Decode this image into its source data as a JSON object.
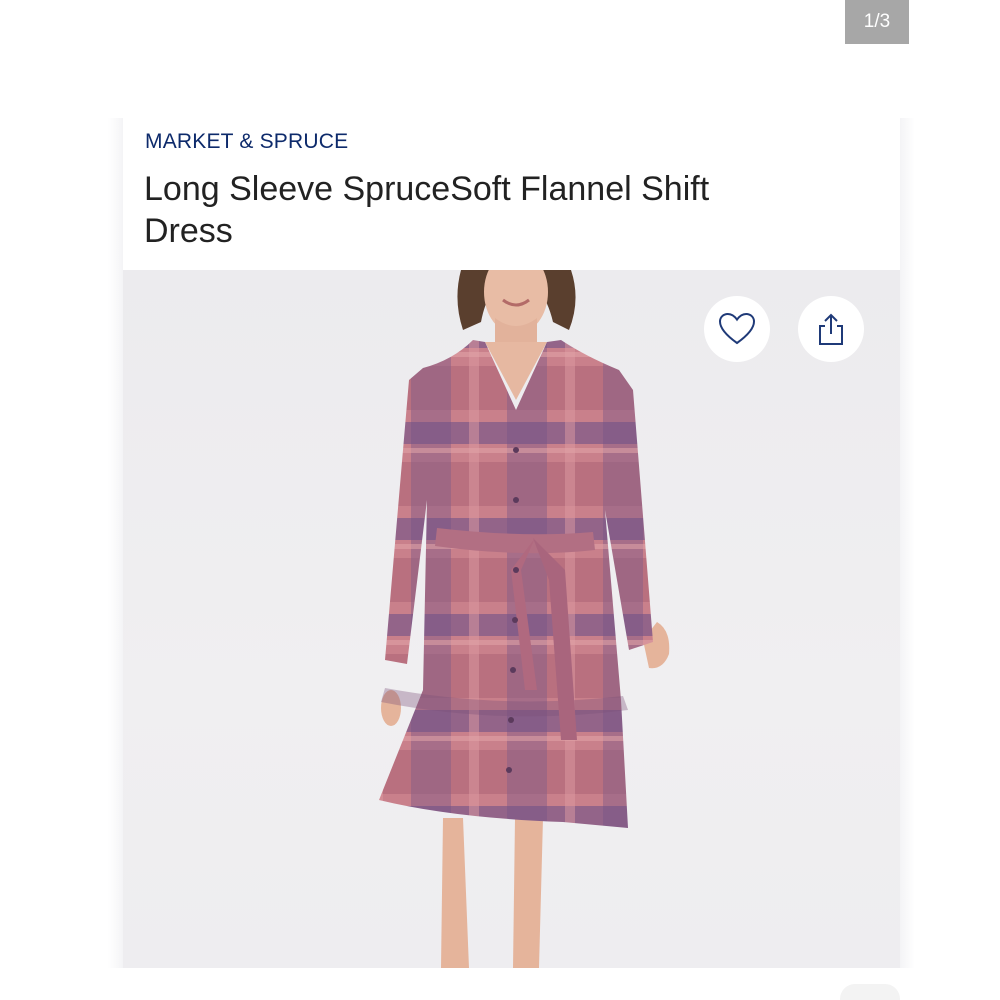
{
  "gallery": {
    "counter": "1/3"
  },
  "product": {
    "brand": "MARKET & SPRUCE",
    "title": "Long Sleeve SpruceSoft Flannel Shift Dress",
    "image_alt": "Model wearing a pink and purple plaid long sleeve flannel shift dress with tie belt"
  },
  "actions": {
    "favorite_icon": "heart-icon",
    "share_icon": "share-icon"
  },
  "colors": {
    "brand": "#0d2a6b",
    "plaid_pink": "#c77a86",
    "plaid_purple": "#6b4f7e"
  }
}
